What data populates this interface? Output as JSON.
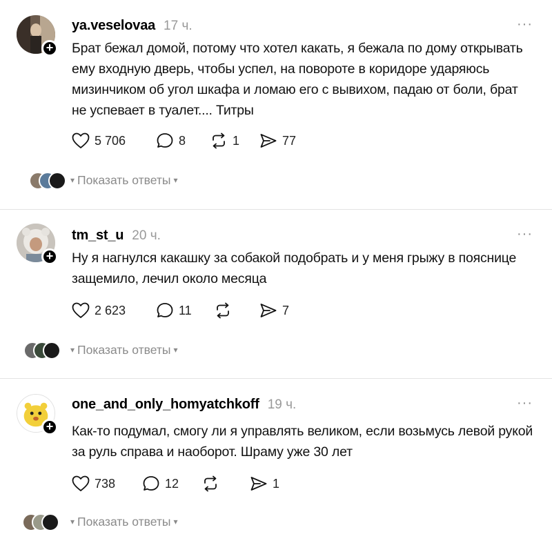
{
  "posts": [
    {
      "username": "ya.veselovaa",
      "time": "17 ч.",
      "text": "Брат бежал домой, потому что хотел какать, я бежала по дому открывать ему входную дверь, чтобы успел, на повороте в коридоре ударяюсь мизинчиком об угол шкафа и ломаю его с вывихом, падаю от боли, брат не успевает в туалет.... Титры",
      "likes": "5 706",
      "comments": "8",
      "reposts": "1",
      "shares": "77",
      "show_replies": "Показать ответы"
    },
    {
      "username": "tm_st_u",
      "time": "20 ч.",
      "text": "Ну я нагнулся какашку за собакой подобрать и у меня грыжу в пояснице защемило, лечил около месяца",
      "likes": "2 623",
      "comments": "11",
      "reposts": "",
      "shares": "7",
      "show_replies": "Показать ответы"
    },
    {
      "username": "one_and_only_homyatchkoff",
      "time": "19 ч.",
      "text": "Как-то подумал, смогу ли я управлять великом, если возьмусь левой рукой за руль справа и наоборот. Шраму уже 30 лет",
      "likes": "738",
      "comments": "12",
      "reposts": "",
      "shares": "1",
      "show_replies": "Показать ответы"
    }
  ],
  "ui": {
    "more_glyph": "···",
    "follow_glyph": "+",
    "chevron_glyph": "⌄"
  },
  "icons": {
    "like": "heart-icon",
    "comment": "comment-bubble-icon",
    "repost": "repost-icon",
    "share": "send-icon"
  },
  "colors": {
    "text": "#111111",
    "muted": "#999999",
    "separator": "#e3e3e3"
  }
}
